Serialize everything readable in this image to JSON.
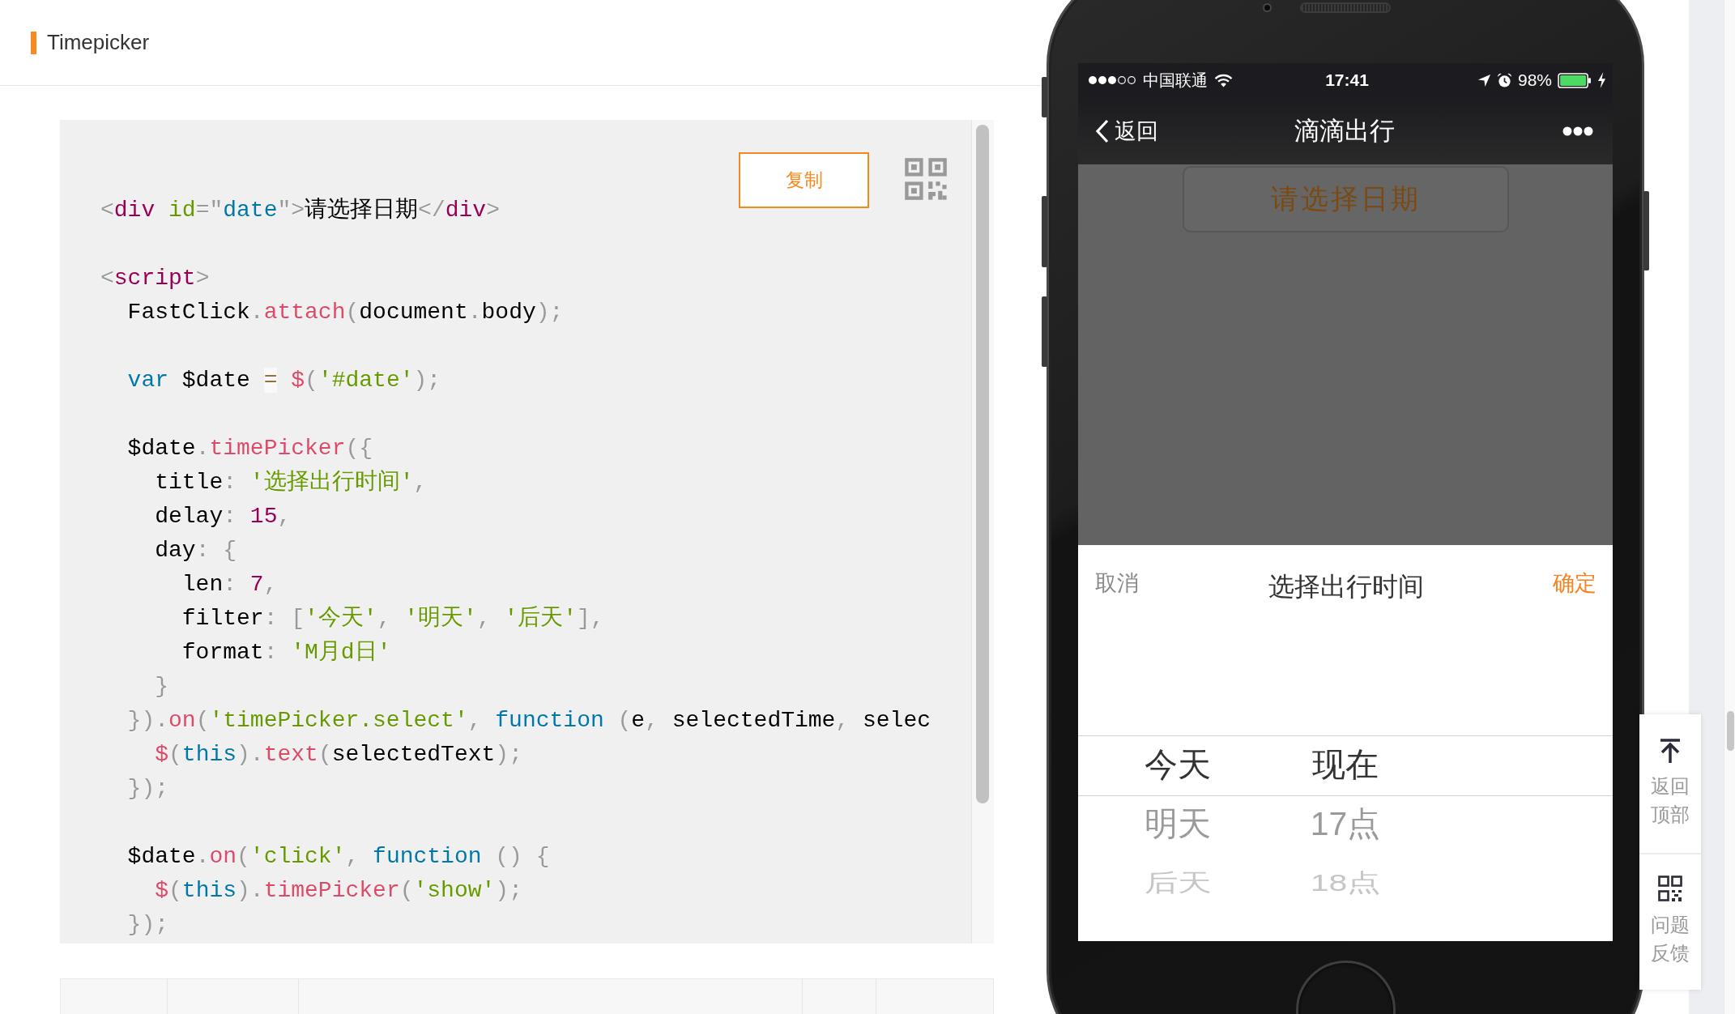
{
  "header": {
    "title": "Timepicker"
  },
  "code_panel": {
    "copy_button": "复制",
    "blocks": [
      {
        "lines": [
          {
            "tokens": [
              {
                "kind": "punct",
                "text": "<"
              },
              {
                "kind": "tag",
                "text": "div"
              },
              {
                "kind": "attr",
                "text": " id"
              },
              {
                "kind": "punct",
                "text": "=\""
              },
              {
                "kind": "value",
                "text": "date"
              },
              {
                "kind": "punct",
                "text": "\""
              },
              {
                "kind": "punct",
                "text": ">"
              },
              {
                "kind": "plain",
                "text": "请选择日期"
              },
              {
                "kind": "punct",
                "text": "</"
              },
              {
                "kind": "tag",
                "text": "div"
              },
              {
                "kind": "punct",
                "text": ">"
              }
            ]
          }
        ]
      },
      {
        "lines": [
          {
            "tokens": [
              {
                "kind": "punct",
                "text": "<"
              },
              {
                "kind": "tag",
                "text": "script"
              },
              {
                "kind": "punct",
                "text": ">"
              }
            ]
          },
          {
            "tokens": [
              {
                "kind": "plain",
                "text": "  FastClick"
              },
              {
                "kind": "punct",
                "text": "."
              },
              {
                "kind": "function",
                "text": "attach"
              },
              {
                "kind": "punct",
                "text": "("
              },
              {
                "kind": "plain",
                "text": "document"
              },
              {
                "kind": "punct",
                "text": "."
              },
              {
                "kind": "plain",
                "text": "body"
              },
              {
                "kind": "punct",
                "text": ");"
              }
            ]
          }
        ]
      },
      {
        "lines": [
          {
            "tokens": [
              {
                "kind": "keyword",
                "text": "  var"
              },
              {
                "kind": "plain",
                "text": " $date "
              },
              {
                "kind": "operator",
                "text": "="
              },
              {
                "kind": "function",
                "text": " $"
              },
              {
                "kind": "punct",
                "text": "("
              },
              {
                "kind": "string",
                "text": "'#date'"
              },
              {
                "kind": "punct",
                "text": ");"
              }
            ]
          }
        ]
      },
      {
        "lines": [
          {
            "tokens": [
              {
                "kind": "plain",
                "text": "  $date"
              },
              {
                "kind": "punct",
                "text": "."
              },
              {
                "kind": "function",
                "text": "timePicker"
              },
              {
                "kind": "punct",
                "text": "({"
              }
            ]
          },
          {
            "tokens": [
              {
                "kind": "plain",
                "text": "    title"
              },
              {
                "kind": "punct",
                "text": ": "
              },
              {
                "kind": "string",
                "text": "'选择出行时间'"
              },
              {
                "kind": "punct",
                "text": ","
              }
            ]
          },
          {
            "tokens": [
              {
                "kind": "plain",
                "text": "    delay"
              },
              {
                "kind": "punct",
                "text": ": "
              },
              {
                "kind": "number",
                "text": "15"
              },
              {
                "kind": "punct",
                "text": ","
              }
            ]
          },
          {
            "tokens": [
              {
                "kind": "plain",
                "text": "    day"
              },
              {
                "kind": "punct",
                "text": ": {"
              }
            ]
          },
          {
            "tokens": [
              {
                "kind": "plain",
                "text": "      len"
              },
              {
                "kind": "punct",
                "text": ": "
              },
              {
                "kind": "number",
                "text": "7"
              },
              {
                "kind": "punct",
                "text": ","
              }
            ]
          },
          {
            "tokens": [
              {
                "kind": "plain",
                "text": "      filter"
              },
              {
                "kind": "punct",
                "text": ": ["
              },
              {
                "kind": "string",
                "text": "'今天'"
              },
              {
                "kind": "punct",
                "text": ", "
              },
              {
                "kind": "string",
                "text": "'明天'"
              },
              {
                "kind": "punct",
                "text": ", "
              },
              {
                "kind": "string",
                "text": "'后天'"
              },
              {
                "kind": "punct",
                "text": "],"
              }
            ]
          },
          {
            "tokens": [
              {
                "kind": "plain",
                "text": "      format"
              },
              {
                "kind": "punct",
                "text": ": "
              },
              {
                "kind": "string",
                "text": "'M月d日'"
              }
            ]
          },
          {
            "tokens": [
              {
                "kind": "punct",
                "text": "    }"
              }
            ]
          },
          {
            "tokens": [
              {
                "kind": "punct",
                "text": "  })."
              },
              {
                "kind": "function",
                "text": "on"
              },
              {
                "kind": "punct",
                "text": "("
              },
              {
                "kind": "string",
                "text": "'timePicker.select'"
              },
              {
                "kind": "punct",
                "text": ", "
              },
              {
                "kind": "keyword",
                "text": "function"
              },
              {
                "kind": "punct",
                "text": " ("
              },
              {
                "kind": "plain",
                "text": "e"
              },
              {
                "kind": "punct",
                "text": ", "
              },
              {
                "kind": "plain",
                "text": "selectedTime"
              },
              {
                "kind": "punct",
                "text": ", "
              },
              {
                "kind": "plain",
                "text": "selec"
              }
            ]
          },
          {
            "tokens": [
              {
                "kind": "function",
                "text": "    $"
              },
              {
                "kind": "punct",
                "text": "("
              },
              {
                "kind": "keyword",
                "text": "this"
              },
              {
                "kind": "punct",
                "text": ")."
              },
              {
                "kind": "function",
                "text": "text"
              },
              {
                "kind": "punct",
                "text": "("
              },
              {
                "kind": "plain",
                "text": "selectedText"
              },
              {
                "kind": "punct",
                "text": ");"
              }
            ]
          },
          {
            "tokens": [
              {
                "kind": "punct",
                "text": "  });"
              }
            ]
          }
        ]
      },
      {
        "lines": [
          {
            "tokens": [
              {
                "kind": "plain",
                "text": "  $date"
              },
              {
                "kind": "punct",
                "text": "."
              },
              {
                "kind": "function",
                "text": "on"
              },
              {
                "kind": "punct",
                "text": "("
              },
              {
                "kind": "string",
                "text": "'click'"
              },
              {
                "kind": "punct",
                "text": ", "
              },
              {
                "kind": "keyword",
                "text": "function"
              },
              {
                "kind": "punct",
                "text": " () {"
              }
            ]
          },
          {
            "tokens": [
              {
                "kind": "function",
                "text": "    $"
              },
              {
                "kind": "punct",
                "text": "("
              },
              {
                "kind": "keyword",
                "text": "this"
              },
              {
                "kind": "punct",
                "text": ")."
              },
              {
                "kind": "function",
                "text": "timePicker"
              },
              {
                "kind": "punct",
                "text": "("
              },
              {
                "kind": "string",
                "text": "'show'"
              },
              {
                "kind": "punct",
                "text": ");"
              }
            ]
          },
          {
            "tokens": [
              {
                "kind": "punct",
                "text": "  });"
              }
            ]
          }
        ]
      }
    ]
  },
  "phone": {
    "status_bar": {
      "carrier": "中国联通",
      "time": "17:41",
      "battery": "98%"
    },
    "nav_bar": {
      "back": "返回",
      "title": "滴滴出行"
    },
    "date_button": "请选择日期",
    "picker": {
      "cancel": "取消",
      "title": "选择出行时间",
      "confirm": "确定",
      "columns": [
        {
          "items": [
            {
              "label": "今天",
              "selected": true
            },
            {
              "label": "明天",
              "selected": false
            },
            {
              "label": "后天",
              "selected": false
            }
          ]
        },
        {
          "items": [
            {
              "label": "现在",
              "selected": true
            },
            {
              "label": "17点",
              "selected": false
            },
            {
              "label": "18点",
              "selected": false
            }
          ]
        }
      ]
    }
  },
  "side_tools": [
    {
      "kind": "back_to_top",
      "label": "返回顶部"
    },
    {
      "kind": "feedback",
      "label": "问题反馈"
    }
  ]
}
